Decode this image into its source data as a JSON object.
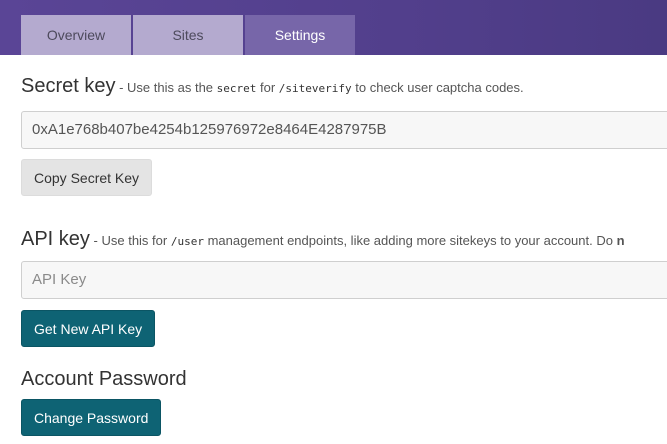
{
  "tabs": [
    {
      "label": "Overview"
    },
    {
      "label": "Sites"
    },
    {
      "label": "Settings"
    }
  ],
  "secret_key": {
    "title": "Secret key",
    "desc_prefix": " - Use this as the ",
    "code1": "secret",
    "desc_mid": " for ",
    "code2": "/siteverify",
    "desc_suffix": " to check user captcha codes.",
    "value": "0xA1e768b407be4254b125976972e8464E4287975B",
    "copy_button": "Copy Secret Key"
  },
  "api_key": {
    "title": "API key",
    "desc_prefix": " - Use this for ",
    "code1": "/user",
    "desc_suffix": " management endpoints, like adding more sitekeys to your account. Do ",
    "desc_cut": "n",
    "placeholder": "API Key",
    "button": "Get New API Key"
  },
  "account_password": {
    "title": "Account Password",
    "button": "Change Password"
  },
  "colors": {
    "header": "#523f8c",
    "tab_active": "#7766a9",
    "tab_inactive": "#b4aacf",
    "primary_button": "#0e6374"
  }
}
